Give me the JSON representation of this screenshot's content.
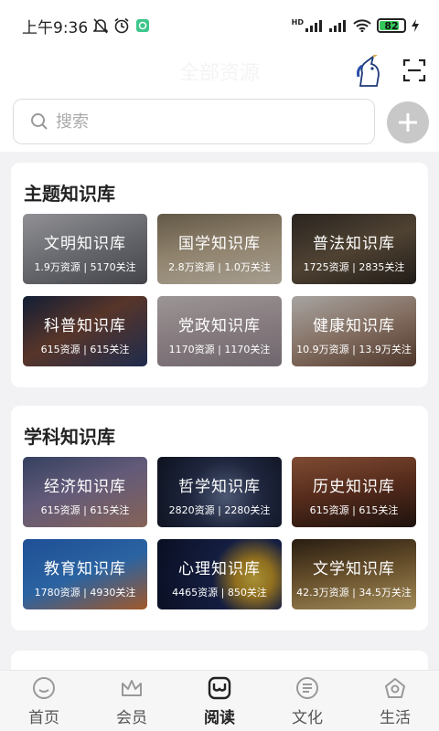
{
  "status_bar": {
    "time": "上午9:36",
    "battery_level": 82,
    "battery_text": "82",
    "network": "HD"
  },
  "header": {
    "title": "全部资源"
  },
  "search": {
    "placeholder": "搜索"
  },
  "topic_section": {
    "title": "主题知识库",
    "cards": [
      {
        "name": "文明知识库",
        "stats": "1.9万资源 | 5170关注"
      },
      {
        "name": "国学知识库",
        "stats": "2.8万资源 | 1.0万关注"
      },
      {
        "name": "普法知识库",
        "stats": "1725资源 | 2835关注"
      },
      {
        "name": "科普知识库",
        "stats": "615资源 | 615关注"
      },
      {
        "name": "党政知识库",
        "stats": "1170资源 | 1170关注"
      },
      {
        "name": "健康知识库",
        "stats": "10.9万资源 | 13.9万关注"
      }
    ]
  },
  "subject_section": {
    "title": "学科知识库",
    "cards": [
      {
        "name": "经济知识库",
        "stats": "615资源 | 615关注"
      },
      {
        "name": "哲学知识库",
        "stats": "2820资源 | 2280关注"
      },
      {
        "name": "历史知识库",
        "stats": "615资源 | 615关注"
      },
      {
        "name": "教育知识库",
        "stats": "1780资源 | 4930关注"
      },
      {
        "name": "心理知识库",
        "stats": "4465资源 | 850关注"
      },
      {
        "name": "文学知识库",
        "stats": "42.3万资源 | 34.5万关注"
      }
    ]
  },
  "tabbar": {
    "tabs": [
      {
        "label": "首页",
        "icon": "home-face-icon"
      },
      {
        "label": "会员",
        "icon": "crown-icon"
      },
      {
        "label": "阅读",
        "icon": "reading-icon",
        "active": true
      },
      {
        "label": "文化",
        "icon": "culture-scroll-icon"
      },
      {
        "label": "生活",
        "icon": "life-icon"
      }
    ]
  },
  "colors": {
    "accent": "#222222",
    "inactive": "#555555",
    "background": "#f2f2f4",
    "battery": "#35c759"
  }
}
